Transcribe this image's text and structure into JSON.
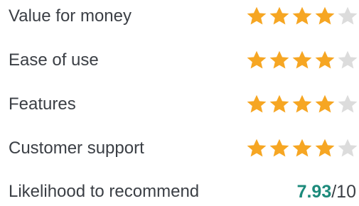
{
  "colors": {
    "text": "#3b3f45",
    "star_filled": "#f6a623",
    "star_empty": "#dcdcdc",
    "score_accent": "#1c8a7b"
  },
  "ratings": [
    {
      "label": "Value for money",
      "stars": 4,
      "max_stars": 5
    },
    {
      "label": "Ease of use",
      "stars": 4,
      "max_stars": 5
    },
    {
      "label": "Features",
      "stars": 4,
      "max_stars": 5
    },
    {
      "label": "Customer support",
      "stars": 4,
      "max_stars": 5
    }
  ],
  "recommend": {
    "label": "Likelihood to recommend",
    "value": "7.93",
    "suffix": "/10"
  }
}
